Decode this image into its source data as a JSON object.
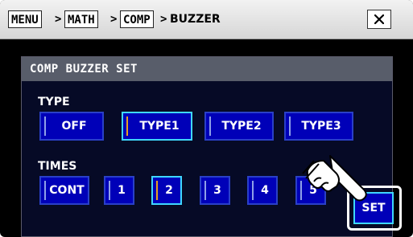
{
  "breadcrumb": {
    "items": [
      "MENU",
      "MATH",
      "COMP"
    ],
    "separator": ">",
    "current": "BUZZER"
  },
  "close_label": "×",
  "panel": {
    "title": "COMP BUZZER SET",
    "type_section": {
      "label": "TYPE",
      "options": [
        "OFF",
        "TYPE1",
        "TYPE2",
        "TYPE3"
      ],
      "selected": "TYPE1"
    },
    "times_section": {
      "label": "TIMES",
      "options": [
        "CONT",
        "1",
        "2",
        "3",
        "4",
        "5"
      ],
      "selected": "2"
    },
    "set_label": "SET"
  },
  "icons": [
    "close-icon",
    "pointing-hand-icon"
  ],
  "colors": {
    "button_fill": "#0000b8",
    "selected_border": "#3fd7ff",
    "selected_bar": "#e8a020",
    "panel_header": "#585d6a"
  }
}
